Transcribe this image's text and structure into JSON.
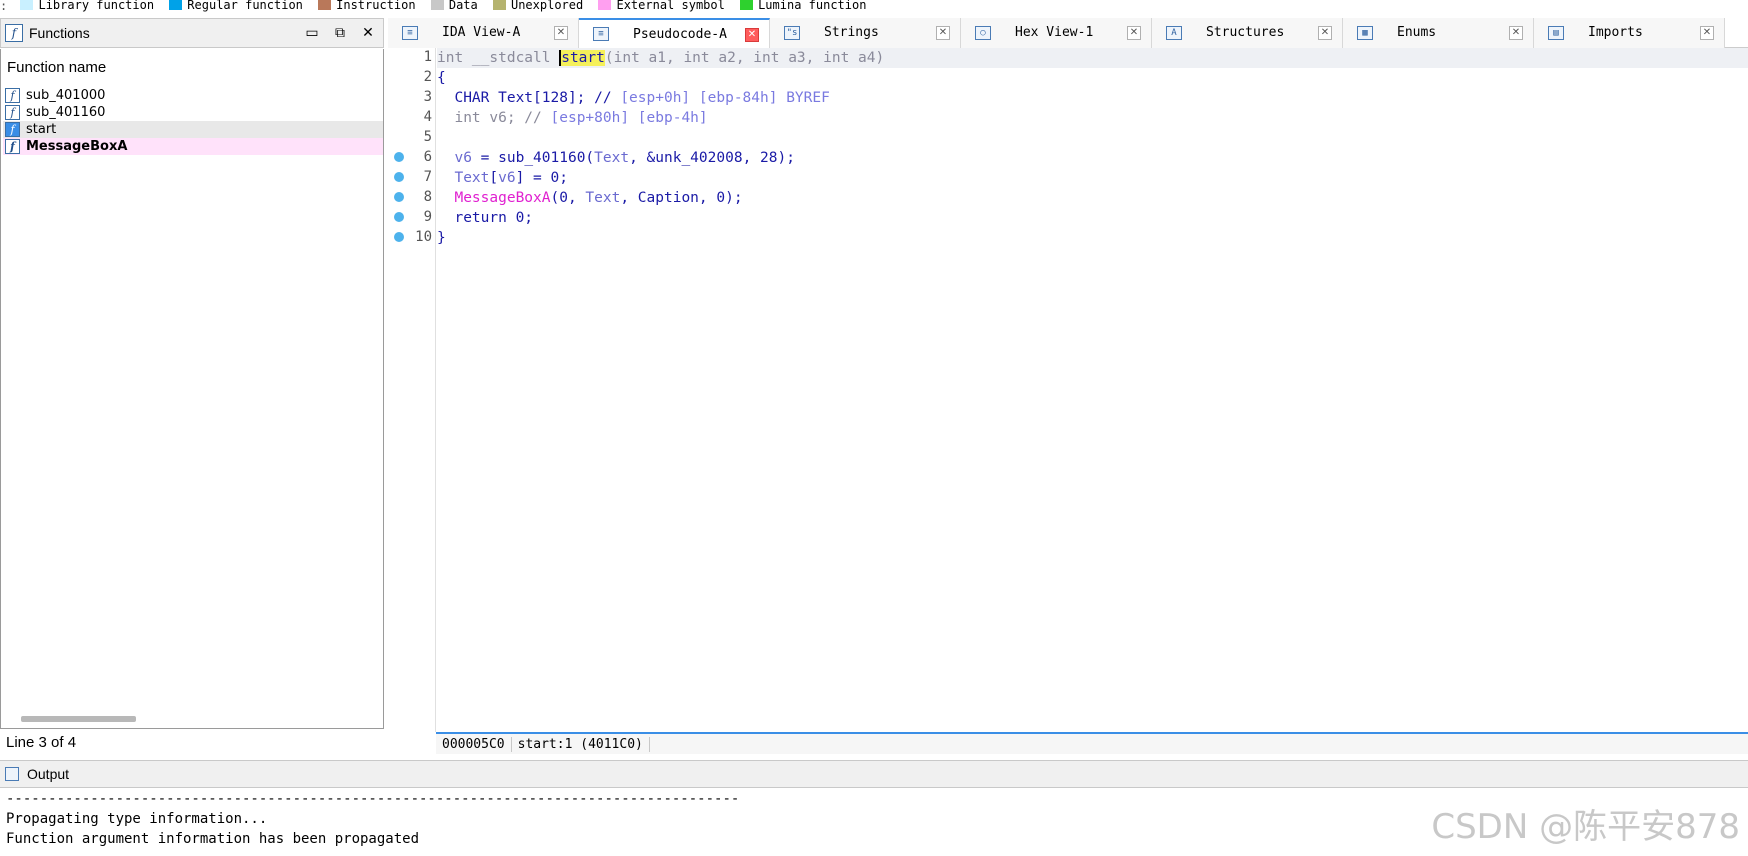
{
  "legend": [
    {
      "label": "Library function",
      "color": "#c9f0ff"
    },
    {
      "label": "Regular function",
      "color": "#00a2e8"
    },
    {
      "label": "Instruction",
      "color": "#b9785a"
    },
    {
      "label": "Data",
      "color": "#c8c8c8"
    },
    {
      "label": "Unexplored",
      "color": "#b5b36e"
    },
    {
      "label": "External symbol",
      "color": "#ff9ff0"
    },
    {
      "label": "Lumina function",
      "color": "#2ed12e"
    }
  ],
  "functions_panel": {
    "title": "Functions",
    "column_header": "Function name",
    "items": [
      "sub_401000",
      "sub_401160",
      "start",
      "MessageBoxA"
    ],
    "status": "Line 3 of 4"
  },
  "tabs": [
    {
      "label": "IDA View-A",
      "icon": "disassembly-icon"
    },
    {
      "label": "Pseudocode-A",
      "icon": "pseudocode-icon"
    },
    {
      "label": "Strings",
      "icon": "strings-icon"
    },
    {
      "label": "Hex View-1",
      "icon": "hex-icon"
    },
    {
      "label": "Structures",
      "icon": "structures-icon"
    },
    {
      "label": "Enums",
      "icon": "enums-icon"
    },
    {
      "label": "Imports",
      "icon": "imports-icon"
    }
  ],
  "code": {
    "line_numbers": [
      "1",
      "2",
      "3",
      "4",
      "5",
      "6",
      "7",
      "8",
      "9",
      "10"
    ],
    "l1": {
      "a": "int __stdcall ",
      "name": "start",
      "b": "(int a1, int a2, int a3, int a4)"
    },
    "l2": "{",
    "l3": {
      "a": "  CHAR Text[128]; // ",
      "b": "[esp+0h] [ebp-84h] BYREF"
    },
    "l4": {
      "a": "  int v6; // ",
      "b": "[esp+80h] [ebp-4h]"
    },
    "l6": {
      "a": "  ",
      "var": "v6",
      "b": " = sub_401160(",
      "arg": "Text",
      "c": ", &unk_402008, 28);"
    },
    "l7": {
      "a": "  ",
      "var": "Text",
      "b": "[",
      "idx": "v6",
      "c": "] = 0;"
    },
    "l8": {
      "a": "  ",
      "fn": "MessageBoxA",
      "b": "(0, ",
      "arg": "Text",
      "c": ", Caption, 0);"
    },
    "l9": "  return 0;",
    "l10": "}"
  },
  "code_status": {
    "address": "000005C0",
    "location": "start:1 (4011C0)"
  },
  "output": {
    "title": "Output",
    "lines": [
      "---------------------------------------------------------------------------------------",
      "Propagating type information...",
      "Function argument information has been propagated"
    ]
  },
  "watermark": "CSDN @陈平安878"
}
